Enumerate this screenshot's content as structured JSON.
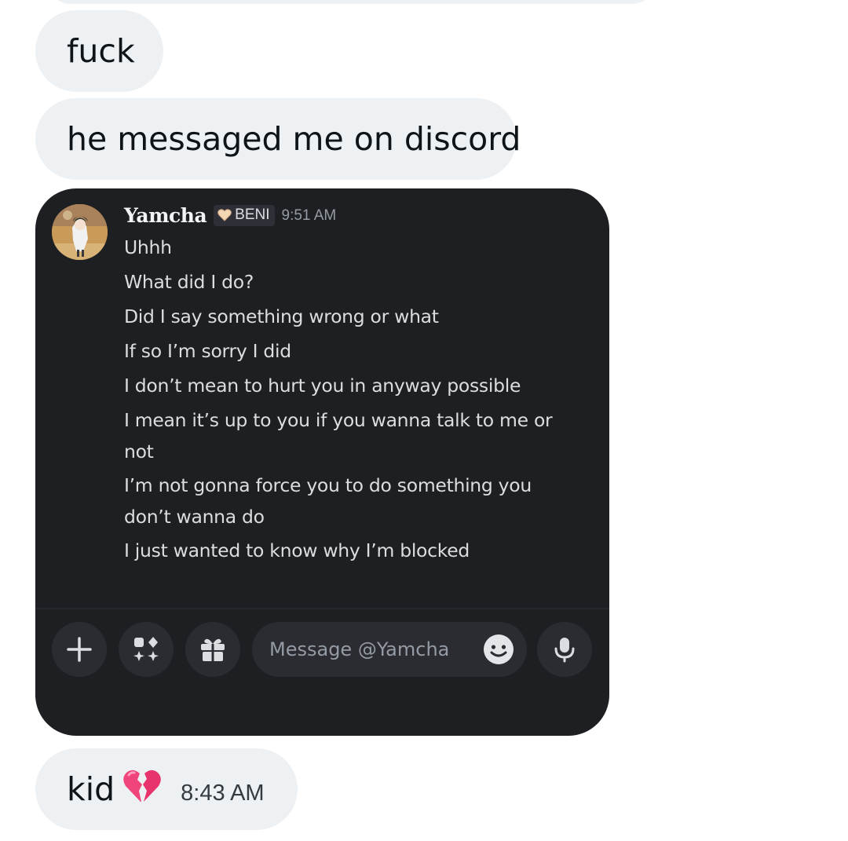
{
  "messages": {
    "first": "fuck",
    "second": "he messaged me on discord",
    "third": "kid",
    "third_time": "8:43 AM"
  },
  "discord": {
    "username": "Yamcha",
    "tag": "BENI",
    "timestamp": "9:51 AM",
    "lines": [
      "Uhhh",
      "What did I do?",
      "Did I say something wrong or what",
      "If so I’m sorry I did",
      "I don’t mean to hurt you in anyway possible",
      "I mean it’s up to you if you wanna talk to me or",
      "not",
      "I’m not gonna force you to do something you",
      "don’t wanna do",
      "I just wanted to know why I’m blocked"
    ],
    "input_placeholder": "Message @Yamcha",
    "icons": [
      "plus-icon",
      "apps-icon",
      "gift-icon",
      "emoji-icon",
      "microphone-icon"
    ]
  },
  "colors": {
    "bubble_bg": "#eef1f3",
    "discord_bg": "#1e1f23",
    "broken_heart": "#f0457a"
  }
}
